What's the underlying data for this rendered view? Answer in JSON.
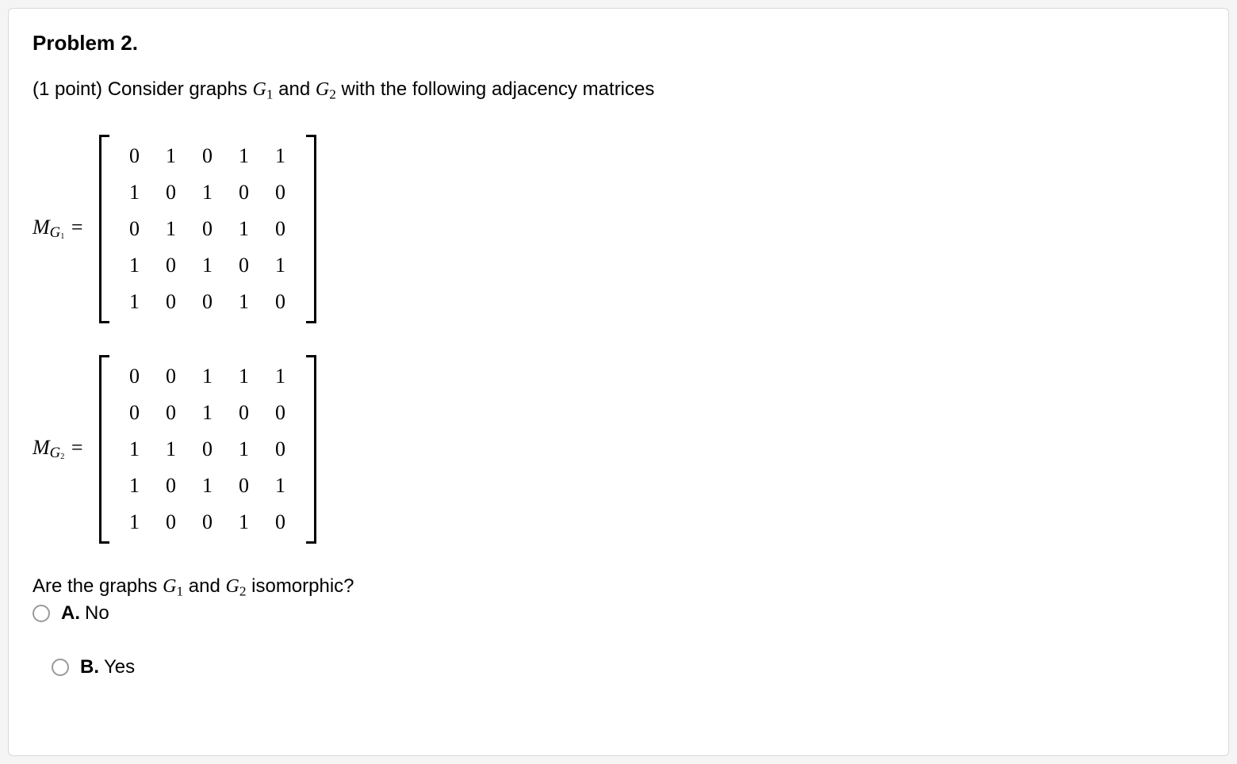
{
  "problem": {
    "title": "Problem 2.",
    "points_prefix": "(1 point) ",
    "intro_before_g1": "Consider graphs ",
    "g1_base": "G",
    "g1_sub": "1",
    "intro_between": " and ",
    "g2_base": "G",
    "g2_sub": "2",
    "intro_after": " with the following adjacency matrices"
  },
  "matrices": {
    "m1": {
      "label_base": "M",
      "label_sub_base": "G",
      "label_sub_sub": "1",
      "eq": "=",
      "rows": [
        [
          "0",
          "1",
          "0",
          "1",
          "1"
        ],
        [
          "1",
          "0",
          "1",
          "0",
          "0"
        ],
        [
          "0",
          "1",
          "0",
          "1",
          "0"
        ],
        [
          "1",
          "0",
          "1",
          "0",
          "1"
        ],
        [
          "1",
          "0",
          "0",
          "1",
          "0"
        ]
      ]
    },
    "m2": {
      "label_base": "M",
      "label_sub_base": "G",
      "label_sub_sub": "2",
      "eq": "=",
      "rows": [
        [
          "0",
          "0",
          "1",
          "1",
          "1"
        ],
        [
          "0",
          "0",
          "1",
          "0",
          "0"
        ],
        [
          "1",
          "1",
          "0",
          "1",
          "0"
        ],
        [
          "1",
          "0",
          "1",
          "0",
          "1"
        ],
        [
          "1",
          "0",
          "0",
          "1",
          "0"
        ]
      ]
    }
  },
  "question": {
    "before_g1": "Are the graphs ",
    "g1_base": "G",
    "g1_sub": "1",
    "between": " and ",
    "g2_base": "G",
    "g2_sub": "2",
    "after": " isomorphic?"
  },
  "options": {
    "a": {
      "letter": "A.",
      "text": "No"
    },
    "b": {
      "letter": "B.",
      "text": "Yes"
    }
  }
}
